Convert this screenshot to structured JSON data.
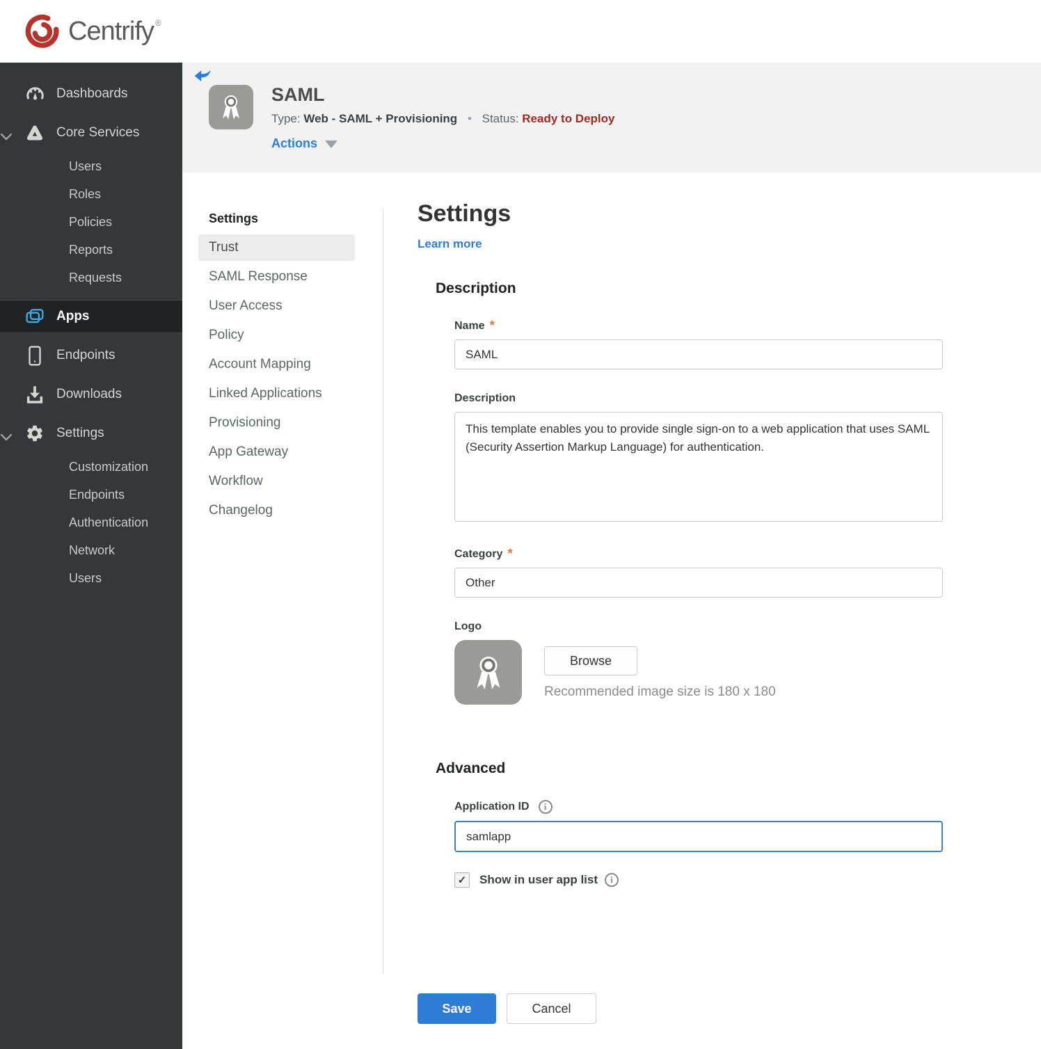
{
  "brand": {
    "name": "Centrify",
    "mark": "®"
  },
  "sidebar": {
    "dashboards": "Dashboards",
    "core_services": "Core Services",
    "core_items": [
      "Users",
      "Roles",
      "Policies",
      "Reports",
      "Requests"
    ],
    "apps": "Apps",
    "endpoints": "Endpoints",
    "downloads": "Downloads",
    "settings": "Settings",
    "settings_items": [
      "Customization",
      "Endpoints",
      "Authentication",
      "Network",
      "Users"
    ]
  },
  "app_header": {
    "title": "SAML",
    "type_label": "Type:",
    "type_value": "Web - SAML + Provisioning",
    "separator": "•",
    "status_label": "Status:",
    "status_value": "Ready to Deploy",
    "actions_label": "Actions"
  },
  "subnav": {
    "header": "Settings",
    "active_item": "Trust",
    "items": [
      "Trust",
      "SAML Response",
      "User Access",
      "Policy",
      "Account Mapping",
      "Linked Applications",
      "Provisioning",
      "App Gateway",
      "Workflow",
      "Changelog"
    ]
  },
  "form": {
    "title": "Settings",
    "learn_more": "Learn more",
    "description_section": {
      "heading": "Description",
      "name_label": "Name",
      "name_required": "*",
      "name_value": "SAML",
      "description_label": "Description",
      "description_value": "This template enables you to provide single sign-on to a web application that uses SAML (Security Assertion Markup Language) for authentication.",
      "category_label": "Category",
      "category_required": "*",
      "category_value": "Other",
      "logo_label": "Logo",
      "browse_label": "Browse",
      "logo_hint": "Recommended image size is 180 x 180"
    },
    "advanced_section": {
      "heading": "Advanced",
      "app_id_label": "Application ID",
      "app_id_value": "samlapp",
      "show_in_list_label": "Show in user app list",
      "show_in_list_checked": true
    },
    "footer": {
      "save_label": "Save",
      "cancel_label": "Cancel"
    }
  },
  "icons": {
    "check": "✓",
    "info": "i"
  },
  "colors": {
    "accent_blue": "#2b7de1",
    "save_blue": "#2e7cd6",
    "status_red": "#a32a20",
    "required_orange": "#e87b2e",
    "sidebar_bg": "#343839",
    "sidebar_active_bg": "#1f2324",
    "sidebar_active_icon": "#41aae8",
    "header_gray": "#f2f2f2",
    "app_icon_gray": "#9a9a96",
    "focus_border": "#3b7fd4"
  }
}
